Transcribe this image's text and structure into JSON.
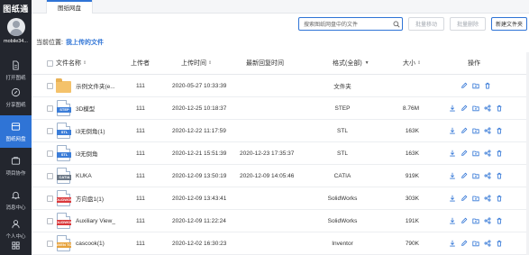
{
  "app": {
    "logo": "图纸通",
    "user_name": "mobile34..."
  },
  "sidebar": {
    "items": [
      {
        "label": "打开图纸",
        "icon": "document-icon"
      },
      {
        "label": "分享图纸",
        "icon": "share-circle-icon"
      },
      {
        "label": "图纸网盘",
        "icon": "cloud-drive-icon",
        "active": true
      },
      {
        "label": "项目协作",
        "icon": "project-icon"
      },
      {
        "label": "消息中心",
        "icon": "bell-icon"
      },
      {
        "label": "个人中心",
        "icon": "person-icon"
      },
      {
        "label": "",
        "icon": "grid-icon"
      }
    ]
  },
  "tabs": [
    {
      "label": "图纸网盘"
    }
  ],
  "toolbar": {
    "search_placeholder": "搜索图纸网盘中的文件",
    "batch_move": "批量移动",
    "batch_delete": "批量删除",
    "new_folder": "新建文件夹"
  },
  "location": {
    "label": "当前位置:",
    "value": "我上传的文件"
  },
  "table": {
    "headers": {
      "name": "文件名称",
      "uploader": "上传者",
      "upload_time": "上传时间",
      "last_reply": "最新回复时间",
      "format": "格式(全部)",
      "size": "大小",
      "actions": "操作"
    },
    "rows": [
      {
        "name": "示例文件夹(e...",
        "uploader": "111",
        "upload_time": "2020-05-27 10:33:39",
        "last_reply": "",
        "format": "文件夹",
        "size": "",
        "icon": "folder",
        "tag": ""
      },
      {
        "name": "3D模型",
        "uploader": "111",
        "upload_time": "2020-12-25 10:18:37",
        "last_reply": "",
        "format": "STEP",
        "size": "8.76M",
        "icon": "doc",
        "tag": "STEP"
      },
      {
        "name": "i3无倒角(1)",
        "uploader": "111",
        "upload_time": "2020-12-22 11:17:59",
        "last_reply": "",
        "format": "STL",
        "size": "163K",
        "icon": "doc",
        "tag": "STL"
      },
      {
        "name": "i3无倒角",
        "uploader": "111",
        "upload_time": "2020-12-21 15:51:39",
        "last_reply": "2020-12-23 17:35:37",
        "format": "STL",
        "size": "163K",
        "icon": "doc",
        "tag": "STL"
      },
      {
        "name": "KUKA",
        "uploader": "111",
        "upload_time": "2020-12-09 13:50:19",
        "last_reply": "2020-12-09 14:05:46",
        "format": "CATIA",
        "size": "919K",
        "icon": "doc",
        "tag": "CATIA"
      },
      {
        "name": "方向盘1(1)",
        "uploader": "111",
        "upload_time": "2020-12-09 13:43:41",
        "last_reply": "",
        "format": "SolidWorks",
        "size": "303K",
        "icon": "doc",
        "tag": "SOLIDWORK"
      },
      {
        "name": "Auxiliary View_",
        "uploader": "111",
        "upload_time": "2020-12-09 11:22:24",
        "last_reply": "",
        "format": "SolidWorks",
        "size": "191K",
        "icon": "doc",
        "tag": "SOLIDWORK"
      },
      {
        "name": "cascook(1)",
        "uploader": "111",
        "upload_time": "2020-12-02 16:30:23",
        "last_reply": "",
        "format": "Inventor",
        "size": "790K",
        "icon": "doc",
        "tag": "INVEN TOR"
      }
    ]
  },
  "colors": {
    "sidebar_bg": "#23262e",
    "accent": "#2f74d6",
    "folder": "#f4c26b",
    "tag_step": "#3b7dd8",
    "tag_stl": "#3b7dd8",
    "tag_catia": "#6b7785",
    "tag_solidworks": "#d9383b",
    "tag_inventor": "#e6a23c"
  }
}
